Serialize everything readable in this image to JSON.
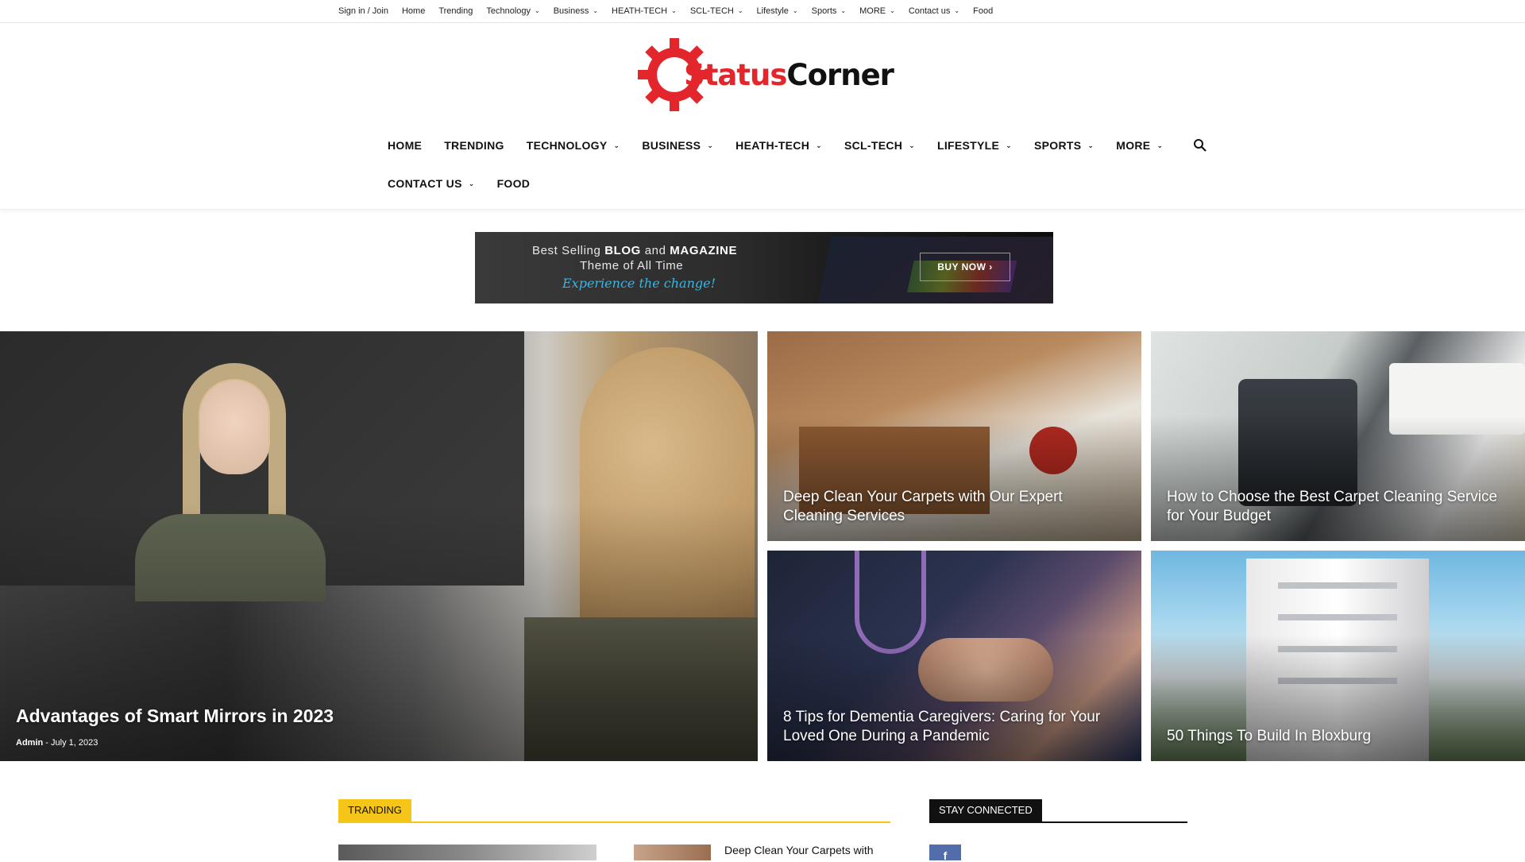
{
  "topbar": {
    "items": [
      {
        "label": "Sign in / Join",
        "dropdown": false
      },
      {
        "label": "Home",
        "dropdown": false
      },
      {
        "label": "Trending",
        "dropdown": false
      },
      {
        "label": "Technology",
        "dropdown": true
      },
      {
        "label": "Business",
        "dropdown": true
      },
      {
        "label": "HEATH-TECH",
        "dropdown": true
      },
      {
        "label": "SCL-TECH",
        "dropdown": true
      },
      {
        "label": "Lifestyle",
        "dropdown": true
      },
      {
        "label": "Sports",
        "dropdown": true
      },
      {
        "label": "MORE",
        "dropdown": true
      },
      {
        "label": "Contact us",
        "dropdown": true
      },
      {
        "label": "Food",
        "dropdown": false
      }
    ]
  },
  "logo": {
    "part1": "Status",
    "part2": "Corner",
    "icon": "gear-icon"
  },
  "mainnav": {
    "row1": [
      {
        "label": "HOME",
        "dropdown": false
      },
      {
        "label": "TRENDING",
        "dropdown": false
      },
      {
        "label": "TECHNOLOGY",
        "dropdown": true
      },
      {
        "label": "BUSINESS",
        "dropdown": true
      },
      {
        "label": "HEATH-TECH",
        "dropdown": true
      },
      {
        "label": "SCL-TECH",
        "dropdown": true
      },
      {
        "label": "LIFESTYLE",
        "dropdown": true
      },
      {
        "label": "SPORTS",
        "dropdown": true
      },
      {
        "label": "MORE",
        "dropdown": true
      }
    ],
    "row2": [
      {
        "label": "CONTACT US",
        "dropdown": true
      },
      {
        "label": "FOOD",
        "dropdown": false
      }
    ],
    "search_icon": "search-icon"
  },
  "banner": {
    "line1_pre": "Best Selling ",
    "line1_b1": "BLOG",
    "line1_mid": " and ",
    "line1_b2": "MAGAZINE",
    "line2": "Theme of All Time",
    "line3": "Experience the change!",
    "button": "BUY NOW ›"
  },
  "featured": {
    "main": {
      "title": "Advantages of Smart Mirrors in 2023",
      "author": "Admin",
      "date": "July 1, 2023"
    },
    "tiles": [
      {
        "title": "Deep Clean Your Carpets with Our Expert Cleaning Services"
      },
      {
        "title": "How to Choose the Best Carpet Cleaning Service for Your Budget"
      },
      {
        "title": "8 Tips for Dementia Caregivers: Caring for Your Loved One During a Pandemic"
      },
      {
        "title": "50 Things To Build In Bloxburg"
      }
    ]
  },
  "sections": {
    "trending": "TRANDING",
    "stay_connected": "STAY CONNECTED",
    "trending_item_title": "Deep Clean Your Carpets with",
    "social_icon": "facebook-icon"
  },
  "colors": {
    "brand_red": "#e3262b",
    "trending_yellow": "#f5c518",
    "facebook_blue": "#516eab"
  }
}
